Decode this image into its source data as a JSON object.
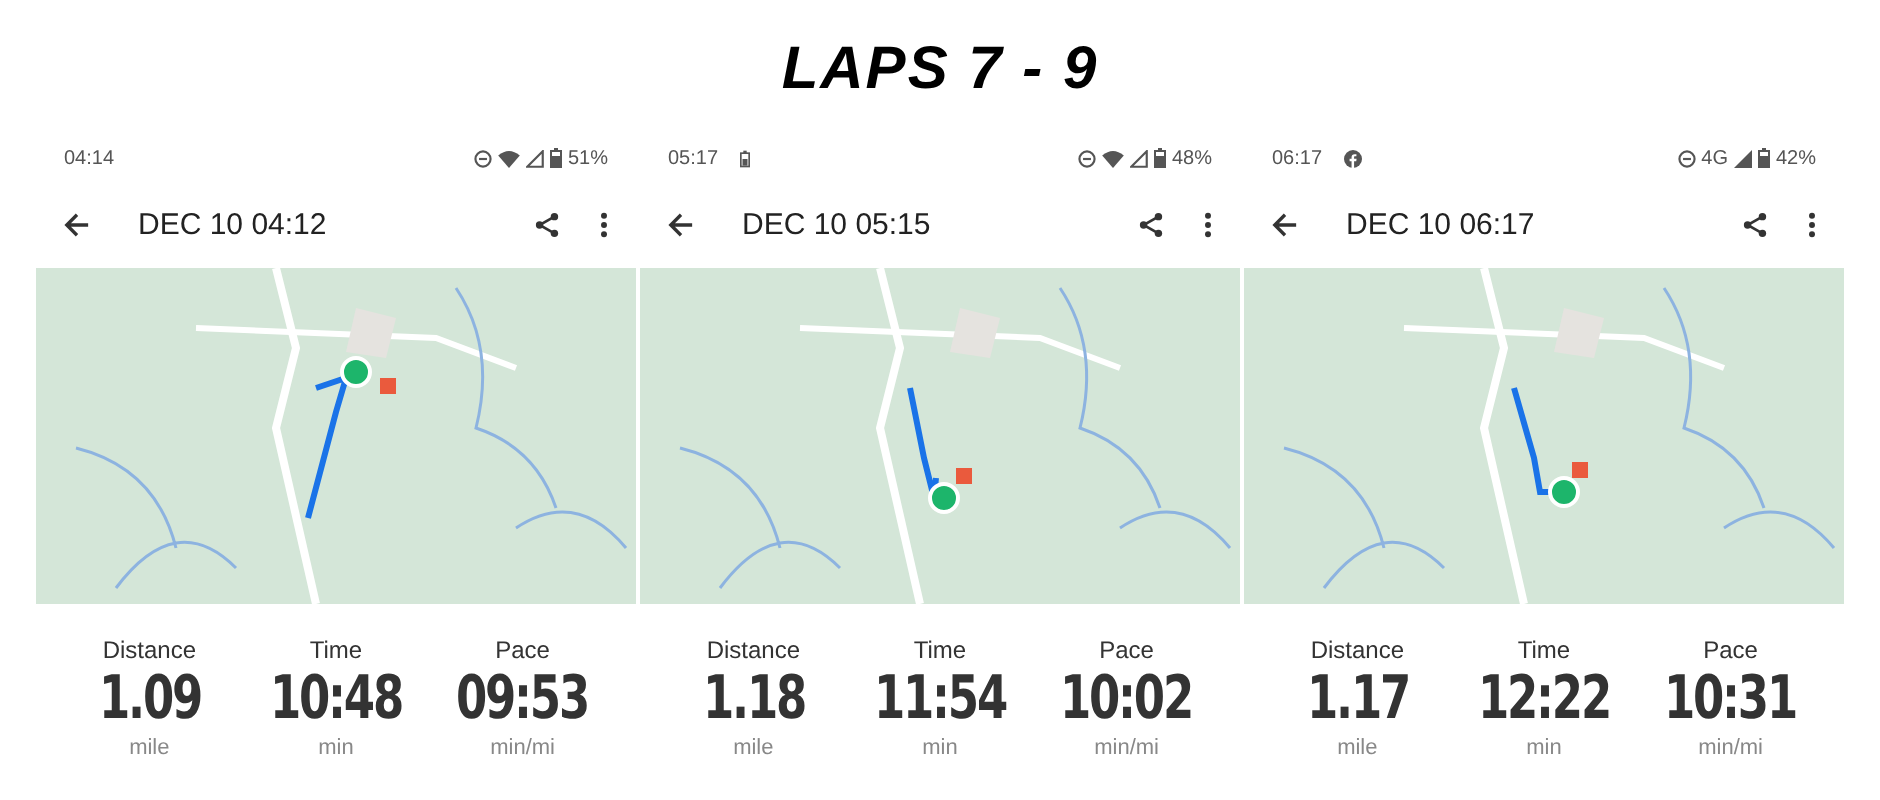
{
  "title": "LAPS 7 - 9",
  "screens": [
    {
      "status_bar": {
        "time": "04:14",
        "icons": [
          {
            "kind": "dnd"
          },
          {
            "kind": "wifi"
          },
          {
            "kind": "signal-outline"
          }
        ],
        "battery": "51%"
      },
      "app_bar": {
        "title": "DEC 10 04:12"
      },
      "stats": [
        {
          "label": "Distance",
          "value": "1.09",
          "unit": "mile"
        },
        {
          "label": "Time",
          "value": "10:48",
          "unit": "min"
        },
        {
          "label": "Pace",
          "value": "09:53",
          "unit": "min/mi"
        }
      ]
    },
    {
      "status_bar": {
        "time": "05:17",
        "notification_icon": {
          "kind": "battery"
        },
        "icons": [
          {
            "kind": "dnd"
          },
          {
            "kind": "wifi"
          },
          {
            "kind": "signal-outline"
          }
        ],
        "battery": "48%"
      },
      "app_bar": {
        "title": "DEC 10 05:15"
      },
      "stats": [
        {
          "label": "Distance",
          "value": "1.18",
          "unit": "mile"
        },
        {
          "label": "Time",
          "value": "11:54",
          "unit": "min"
        },
        {
          "label": "Pace",
          "value": "10:02",
          "unit": "min/mi"
        }
      ]
    },
    {
      "status_bar": {
        "time": "06:17",
        "notification_icon": {
          "kind": "facebook"
        },
        "icons": [
          {
            "kind": "dnd"
          },
          {
            "kind": "text",
            "label": "4G"
          },
          {
            "kind": "signal"
          }
        ],
        "battery": "42%"
      },
      "app_bar": {
        "title": "DEC 10 06:17"
      },
      "stats": [
        {
          "label": "Distance",
          "value": "1.17",
          "unit": "mile"
        },
        {
          "label": "Time",
          "value": "12:22",
          "unit": "min"
        },
        {
          "label": "Pace",
          "value": "10:31",
          "unit": "min/mi"
        }
      ]
    }
  ]
}
